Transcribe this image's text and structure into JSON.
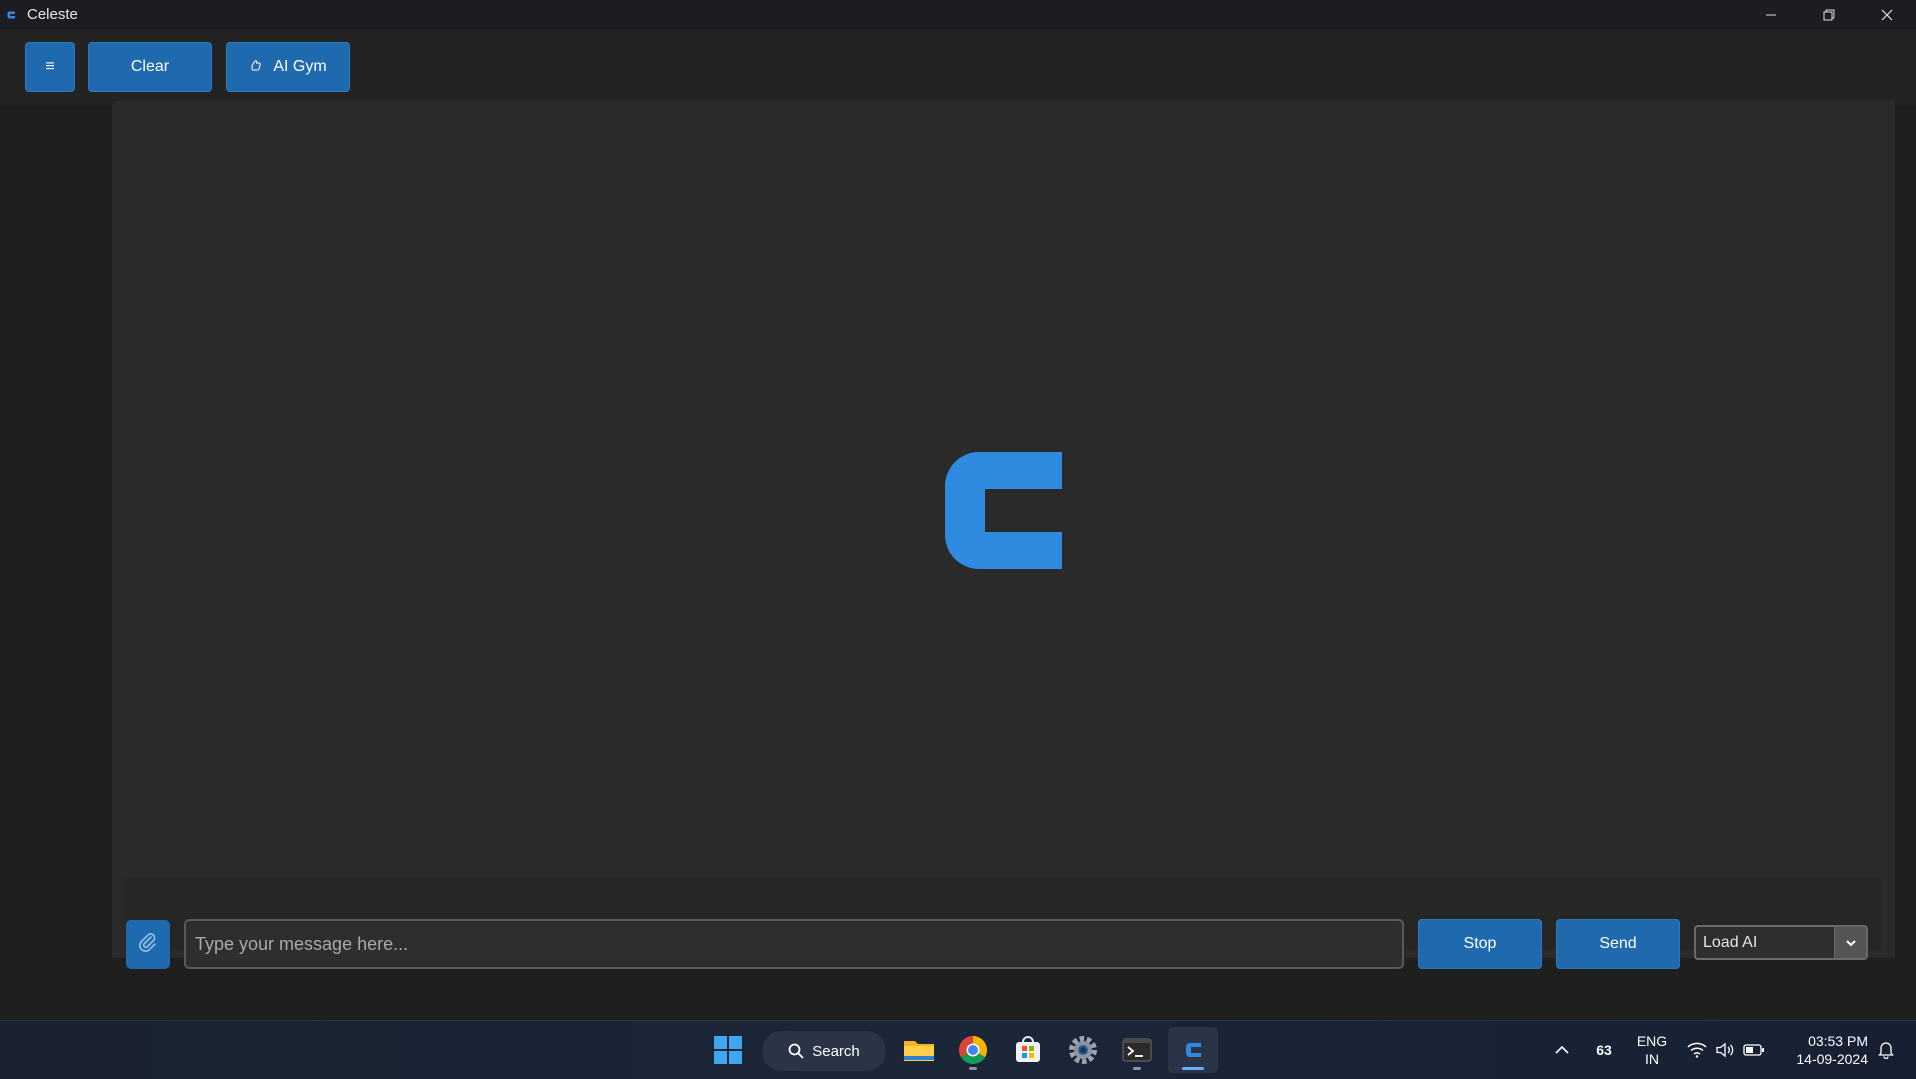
{
  "window": {
    "title": "Celeste"
  },
  "toolbar": {
    "menu_label": "≡",
    "clear_label": "Clear",
    "gym_label": "AI Gym"
  },
  "chat": {
    "placeholder": "Type your message here...",
    "stop_label": "Stop",
    "send_label": "Send",
    "model_selected": "Load AI"
  },
  "colors": {
    "accent": "#1f69ae",
    "logo": "#2f8be0",
    "panel": "#2a2a2a",
    "background": "#1f1f1f"
  },
  "taskbar": {
    "search_label": "Search",
    "weather": "63",
    "lang_line1": "ENG",
    "lang_line2": "IN",
    "time": "03:53 PM",
    "date": "14-09-2024",
    "icons": [
      "windows-start-icon",
      "search-icon",
      "file-explorer-icon",
      "chrome-icon",
      "microsoft-store-icon",
      "settings-icon",
      "terminal-icon",
      "celeste-icon"
    ]
  }
}
